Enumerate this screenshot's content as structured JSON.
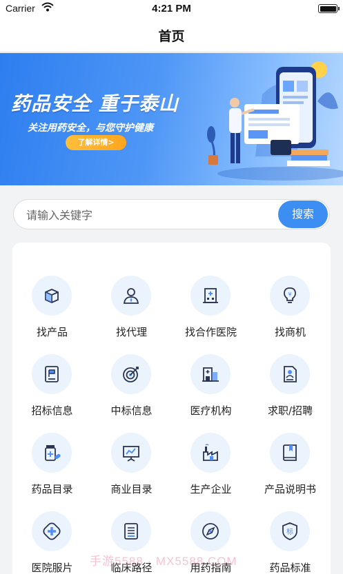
{
  "status_bar": {
    "carrier": "Carrier",
    "time": "4:21 PM"
  },
  "nav": {
    "title": "首页"
  },
  "banner": {
    "headline": "药品安全 重于泰山",
    "subline": "关注用药安全，与您守护健康",
    "cta": "了解详情>"
  },
  "search": {
    "placeholder": "请输入关键字",
    "button": "搜索"
  },
  "colors": {
    "accent": "#3d8ef2",
    "icon_stroke": "#2a3350",
    "icon_circle": "#ebf3fd"
  },
  "grid": [
    {
      "label": "找产品",
      "icon": "box-icon"
    },
    {
      "label": "找代理",
      "icon": "agent-person-icon"
    },
    {
      "label": "找合作医院",
      "icon": "hospital-icon"
    },
    {
      "label": "找商机",
      "icon": "lightbulb-icon"
    },
    {
      "label": "招标信息",
      "icon": "flag-document-icon"
    },
    {
      "label": "中标信息",
      "icon": "target-icon"
    },
    {
      "label": "医疗机构",
      "icon": "building-icon"
    },
    {
      "label": "求职/招聘",
      "icon": "resume-icon"
    },
    {
      "label": "药品目录",
      "icon": "medicine-bottle-icon"
    },
    {
      "label": "商业目录",
      "icon": "presentation-board-icon"
    },
    {
      "label": "生产企业",
      "icon": "factory-icon"
    },
    {
      "label": "产品说明书",
      "icon": "book-icon"
    },
    {
      "label": "医院服片",
      "icon": "medical-cross-icon"
    },
    {
      "label": "临床路径",
      "icon": "document-lines-icon"
    },
    {
      "label": "用药指南",
      "icon": "compass-icon"
    },
    {
      "label": "药品标准",
      "icon": "standard-shield-icon"
    }
  ],
  "watermark": "手游5588 · MX5588.COM"
}
